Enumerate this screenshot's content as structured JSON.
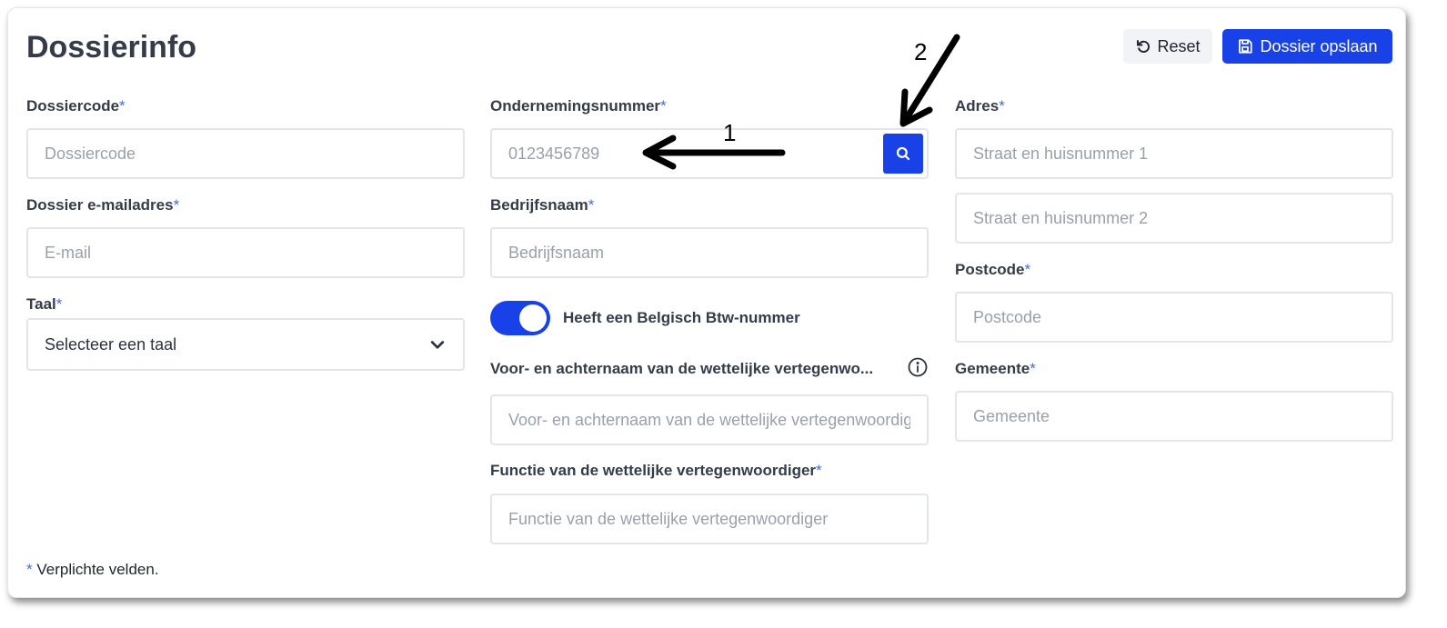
{
  "page": {
    "title": "Dossierinfo",
    "reset_label": "Reset",
    "save_label": "Dossier opslaan",
    "footnote_star": "*",
    "footnote_text": " Verplichte velden."
  },
  "fields": {
    "required_marker": "*",
    "dossiercode": {
      "label": "Dossiercode",
      "placeholder": "Dossiercode",
      "value": ""
    },
    "email": {
      "label": "Dossier e-mailadres",
      "placeholder": "E-mail",
      "value": ""
    },
    "taal": {
      "label": "Taal",
      "selected": "Selecteer een taal"
    },
    "ondernemingsnummer": {
      "label": "Ondernemingsnummer",
      "placeholder": "0123456789",
      "value": ""
    },
    "bedrijfsnaam": {
      "label": "Bedrijfsnaam",
      "placeholder": "Bedrijfsnaam",
      "value": ""
    },
    "btw_toggle": {
      "label": "Heeft een Belgisch Btw-nummer",
      "on": true
    },
    "vertegenwoordiger_naam": {
      "label": "Voor- en achternaam van de wettelijke vertegenwo...",
      "placeholder": "Voor- en achternaam van de wettelijke vertegenwoordiger",
      "value": ""
    },
    "vertegenwoordiger_functie": {
      "label": "Functie van de wettelijke vertegenwoordiger",
      "placeholder": "Functie van de wettelijke vertegenwoordiger",
      "value": ""
    },
    "adres": {
      "label": "Adres",
      "placeholder1": "Straat en huisnummer 1",
      "placeholder2": "Straat en huisnummer 2"
    },
    "postcode": {
      "label": "Postcode",
      "placeholder": "Postcode",
      "value": ""
    },
    "gemeente": {
      "label": "Gemeente",
      "placeholder": "Gemeente",
      "value": ""
    }
  },
  "annotations": {
    "one": "1",
    "two": "2"
  },
  "colors": {
    "primary": "#1842e8",
    "required": "#3e6de0",
    "border": "#e2e5ea"
  },
  "icons": {
    "reset": "undo-icon",
    "save": "floppy-disk-icon",
    "search": "search-icon",
    "select": "chevron-down-icon",
    "info": "info-icon"
  }
}
